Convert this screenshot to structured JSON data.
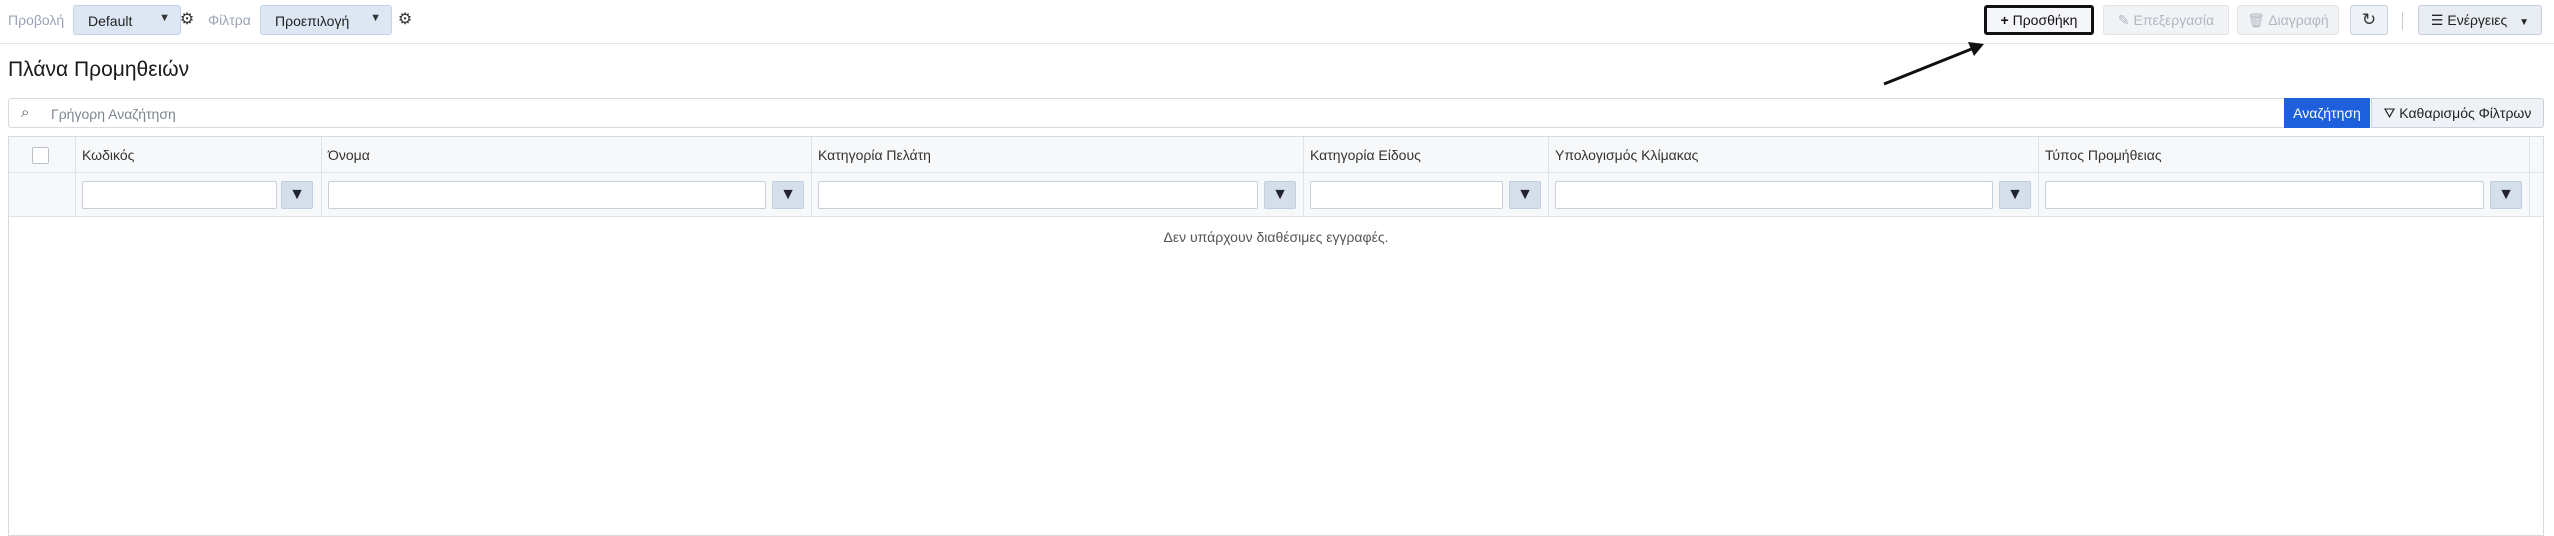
{
  "toolbar": {
    "view_label": "Προβολή",
    "view_value": "Default",
    "filters_label": "Φίλτρα",
    "filters_value": "Προεπιλογή",
    "add_label": "Προσθήκη",
    "edit_label": "Επεξεργασία",
    "delete_label": "Διαγραφή",
    "actions_label": "Ενέργειες"
  },
  "page": {
    "title": "Πλάνα Προμηθειών"
  },
  "search": {
    "placeholder": "Γρήγορη Αναζήτηση",
    "search_button": "Αναζήτηση",
    "clear_button": "Καθαρισμός Φίλτρων"
  },
  "grid": {
    "columns": [
      {
        "label": "Κωδικός"
      },
      {
        "label": "Όνομα"
      },
      {
        "label": "Κατηγορία Πελάτη"
      },
      {
        "label": "Κατηγορία Είδους"
      },
      {
        "label": "Υπολογισμός Κλίμακας"
      },
      {
        "label": "Τύπος Προμήθειας"
      }
    ],
    "empty_message": "Δεν υπάρχουν διαθέσιμες εγγραφές."
  },
  "icons": {
    "gear": "gear-icon",
    "plus": "plus-icon",
    "pencil": "pencil-icon",
    "trash": "trash-icon",
    "refresh": "refresh-icon",
    "menu": "menu-icon",
    "search": "search-icon",
    "filter": "filter-icon",
    "clear_filter": "clear-filter-icon"
  },
  "colors": {
    "primary": "#1e5fdc",
    "header_bg": "#f6f8fa",
    "dropdown_bg": "#dde7f3"
  }
}
